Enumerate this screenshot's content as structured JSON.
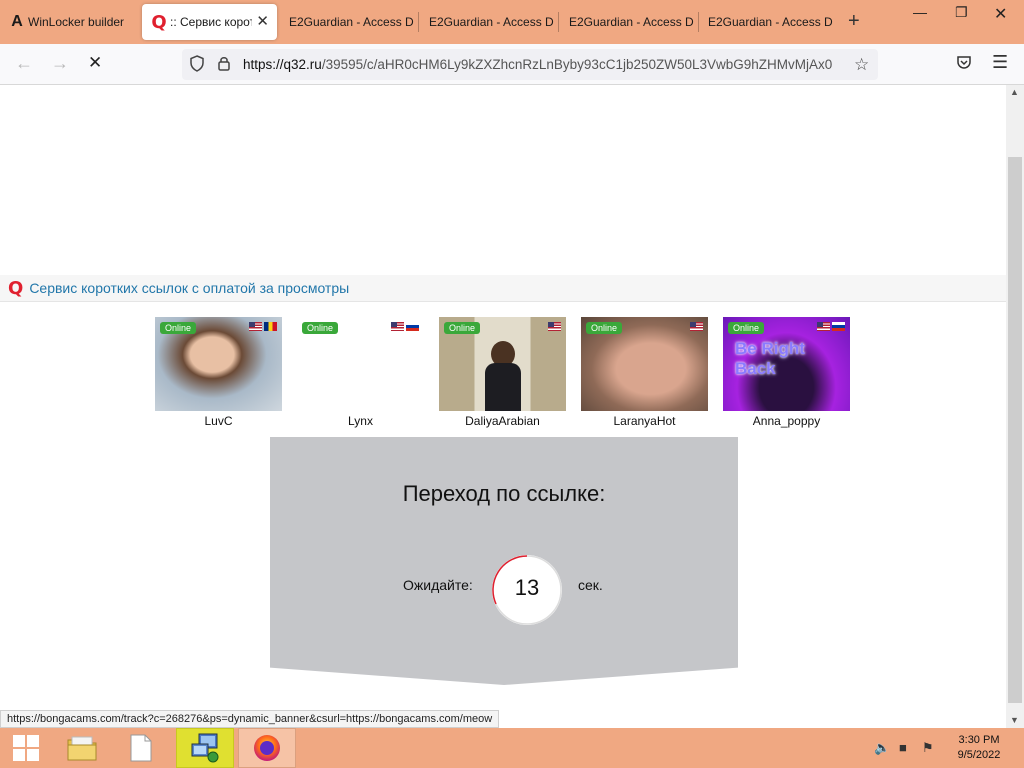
{
  "tabs": [
    {
      "label": "WinLocker builder",
      "icon": "letter-a-icon",
      "active": false
    },
    {
      "label": ":: Сервис корот",
      "icon": "q-logo-icon",
      "active": true
    },
    {
      "label": "E2Guardian - Access D",
      "active": false
    },
    {
      "label": "E2Guardian - Access D",
      "active": false
    },
    {
      "label": "E2Guardian - Access D",
      "active": false
    },
    {
      "label": "E2Guardian - Access D",
      "active": false
    }
  ],
  "navbar": {
    "url_host": "https://q32.ru",
    "url_path": "/39595/c/aHR0cHM6Ly9kZXZhcnRzLnByby93cC1jb250ZW50L3VwbG9hZHMvMjAx0"
  },
  "site": {
    "logo": "Q",
    "title": "Сервис коротких ссылок с оплатой за просмотры"
  },
  "cams": [
    {
      "name": "LuvC",
      "status": "Online",
      "flags": [
        "us",
        "ro"
      ]
    },
    {
      "name": "Lynx",
      "status": "Online",
      "flags": [
        "us",
        "ru"
      ]
    },
    {
      "name": "DaliyaArabian",
      "status": "Online",
      "flags": [
        "us"
      ]
    },
    {
      "name": "LaranyaHot",
      "status": "Online",
      "flags": [
        "us"
      ]
    },
    {
      "name": "Anna_poppy",
      "status": "Online",
      "flags": [
        "us",
        "ru"
      ],
      "overlay": "Be Right Back"
    }
  ],
  "redirect": {
    "title": "Переход по ссылке:",
    "wait_label": "Ожидайте:",
    "countdown": "13",
    "unit_label": "сек."
  },
  "status_bar": {
    "link": "https://bongacams.com/track?c=268276&ps=dynamic_banner&csurl=https://bongacams.com/meow"
  },
  "taskbar": {
    "time": "3:30 PM",
    "date": "9/5/2022"
  },
  "colors": {
    "chrome": "#f0a882",
    "online_badge": "#3aa83a",
    "logo_red": "#e0202f",
    "site_title": "#2277aa",
    "redirect_box": "#c5c6c9"
  }
}
